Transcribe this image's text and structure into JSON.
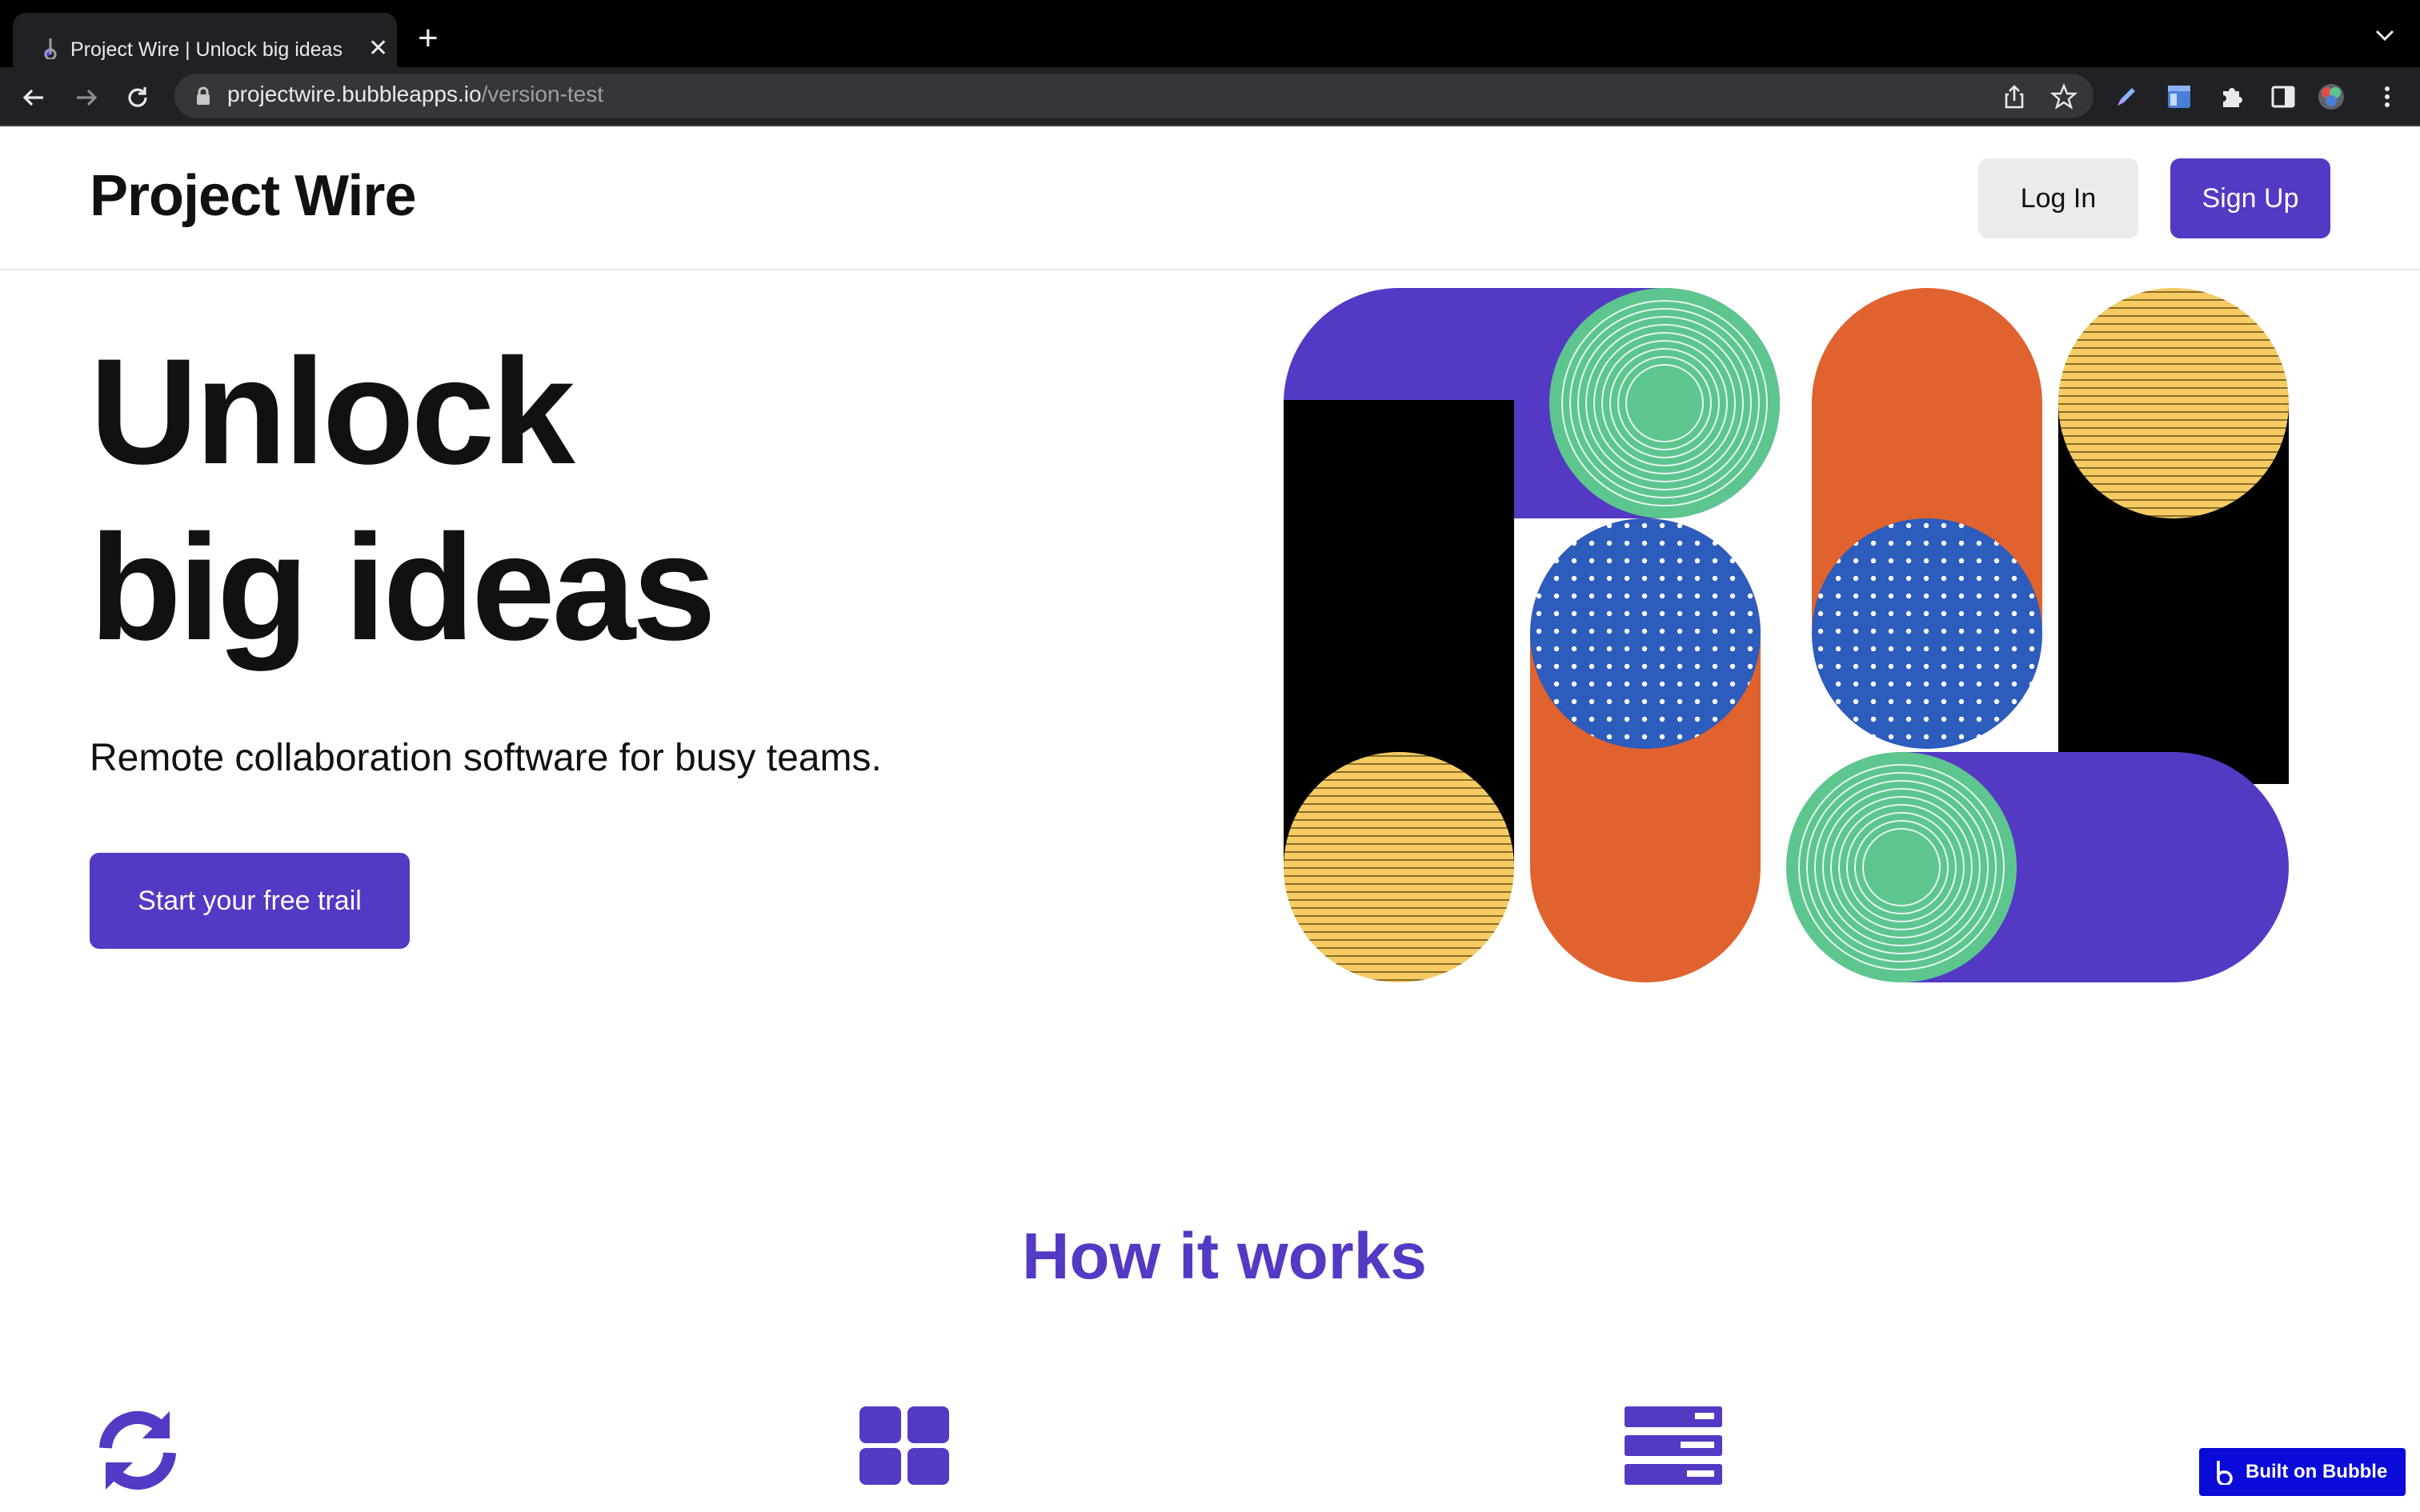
{
  "browser": {
    "tab_title": "Project Wire | Unlock big ideas",
    "tab_close": "✕",
    "new_tab": "+",
    "url_host": "projectwire.bubbleapps.io",
    "url_path": "/version-test"
  },
  "header": {
    "brand": "Project Wire",
    "login_label": "Log In",
    "signup_label": "Sign Up"
  },
  "hero": {
    "title_line1": "Unlock",
    "title_line2": "big ideas",
    "subtitle": "Remote collaboration software for busy teams.",
    "cta_label": "Start your free trail"
  },
  "how": {
    "title": "How it works",
    "features": [
      {
        "icon": "sync-icon"
      },
      {
        "icon": "grid-icon"
      },
      {
        "icon": "server-icon"
      }
    ]
  },
  "badge": {
    "label": "Built on Bubble"
  },
  "colors": {
    "brand_purple": "#5339c4",
    "green": "#5cc68e",
    "orange": "#e0622e",
    "yellow": "#f5cb62",
    "blue": "#2c5cbc",
    "black": "#000000"
  }
}
